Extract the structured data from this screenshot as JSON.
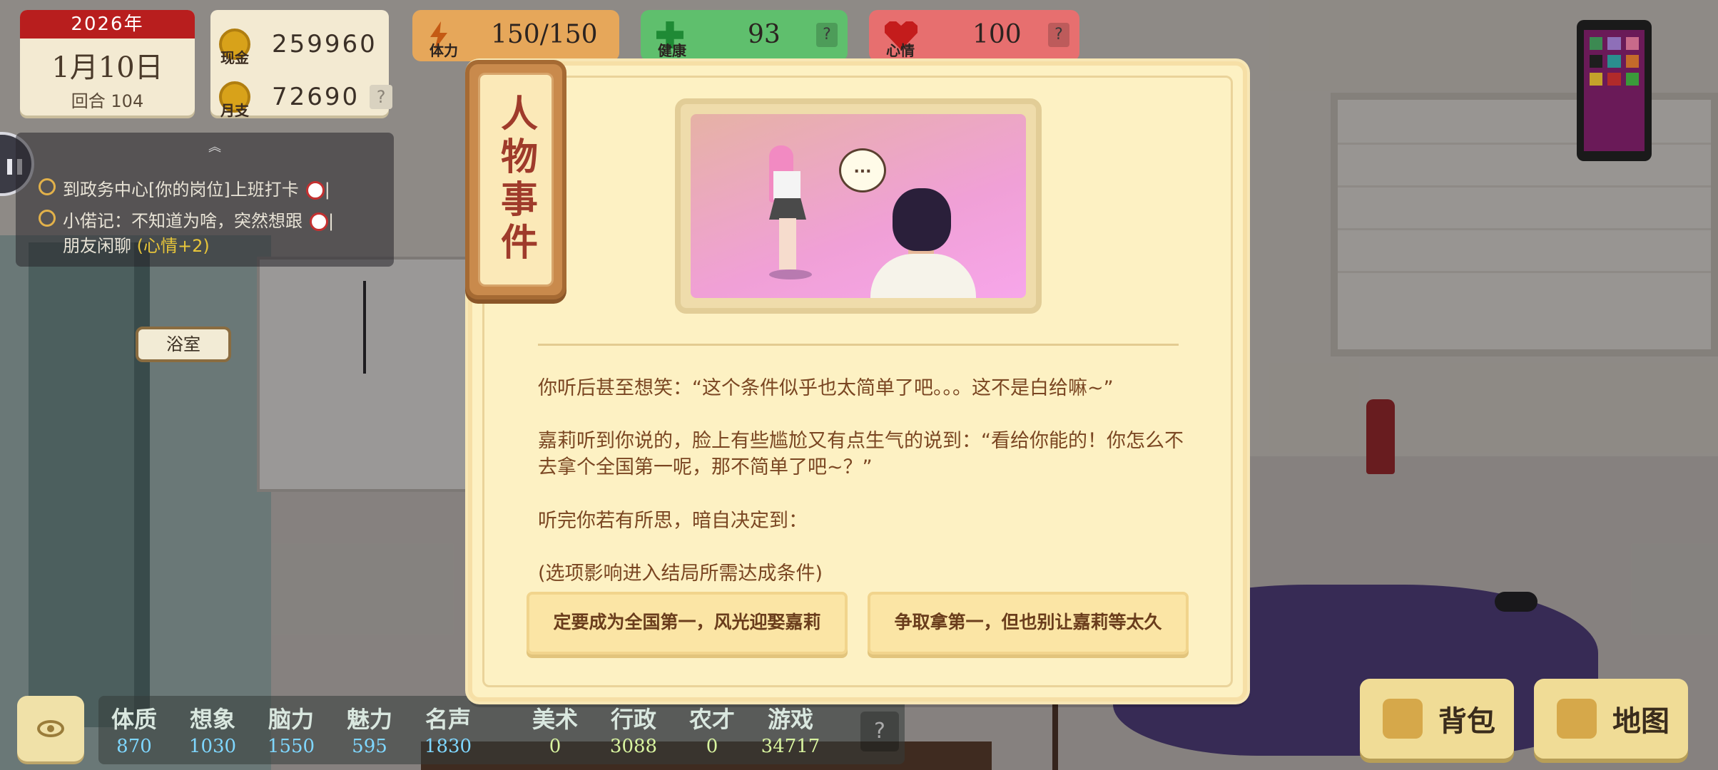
{
  "hud": {
    "year": "2026年",
    "date": "1月10日",
    "round": "回合 104",
    "cash_label": "现金",
    "cash_value": "259960",
    "expense_label": "月支",
    "expense_value": "72690",
    "help": "?",
    "energy_label": "体力",
    "energy_value": "150/150",
    "health_label": "健康",
    "health_value": "93",
    "mood_label": "心情",
    "mood_value": "100"
  },
  "tasks": [
    {
      "text": "到政务中心[你的岗位]上班打卡",
      "suffix": "|"
    },
    {
      "text": "小偌记：不知道为啥，突然想跟",
      "suffix": "|",
      "line2": "朋友闲聊",
      "mood": "(心情+2)"
    }
  ],
  "room": {
    "bath_label": "浴室"
  },
  "attributes": [
    {
      "label": "体质",
      "value": "870"
    },
    {
      "label": "想象",
      "value": "1030"
    },
    {
      "label": "脑力",
      "value": "1550"
    },
    {
      "label": "魅力",
      "value": "595"
    },
    {
      "label": "名声",
      "value": "1830"
    }
  ],
  "skills": [
    {
      "label": "美术",
      "value": "0"
    },
    {
      "label": "行政",
      "value": "3088"
    },
    {
      "label": "农才",
      "value": "0"
    },
    {
      "label": "游戏",
      "value": "34717"
    }
  ],
  "buttons": {
    "bag": "背包",
    "map": "地图"
  },
  "event": {
    "title": "人物事件",
    "bubble": "...",
    "paragraphs": [
      "你听后甚至想笑：“这个条件似乎也太简单了吧。。。这不是白给嘛~”",
      "嘉莉听到你说的，脸上有些尴尬又有点生气的说到：“看给你能的！你怎么不去拿个全国第一呢，那不简单了吧~？”",
      "听完你若有所思，暗自决定到：",
      "(选项影响进入结局所需达成条件)"
    ],
    "choices": [
      "定要成为全国第一，风光迎娶嘉莉",
      "争取拿第一，但也别让嘉莉等太久"
    ]
  },
  "colors": {
    "energy": "#e6a75a",
    "health": "#5fbf6d",
    "mood": "#e76f6f",
    "dialog_bg": "#fdf1c3",
    "title_text": "#9f3b2b",
    "story_text": "#7a4622"
  }
}
